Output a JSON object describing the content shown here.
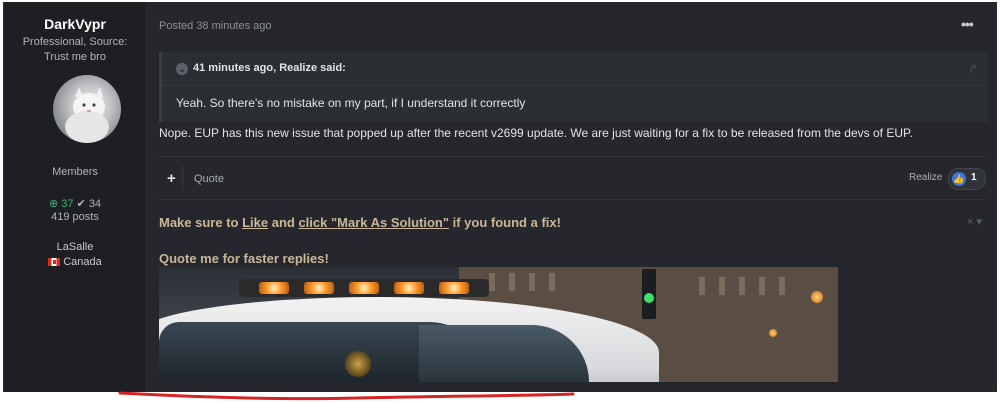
{
  "author": {
    "name": "DarkVypr",
    "title_line1": "Professional, Source:",
    "title_line2": "Trust me bro",
    "group": "Members",
    "reputation_positive": "37",
    "reputation_neutral": "34",
    "posts": "419 posts",
    "location_city": "LaSalle",
    "location_country": "Canada"
  },
  "post": {
    "meta": "Posted 38 minutes ago",
    "menu_icon": "more-dots-icon",
    "quote": {
      "header": "41 minutes ago, Realize said:",
      "text": "Yeah. So there's no mistake on my part, if I understand it correctly"
    },
    "body": "Nope. EUP has this new issue that popped up after the recent v2699 update. We are just waiting for a fix to be released from the devs of EUP.",
    "actions": {
      "add_label": "+",
      "quote_label": "Quote"
    },
    "reactions": {
      "user": "Realize",
      "count": "1",
      "icon": "thumbs-up-icon"
    }
  },
  "signature": {
    "line1_prefix": "Make sure to ",
    "line1_like": "Like",
    "line1_and": " and ",
    "line1_mark": "click \"Mark As Solution\"",
    "line1_suffix": " if you found a fix!",
    "line2": "Quote me for faster replies!",
    "close_label": "× ▾"
  },
  "colors": {
    "background": "#25272c",
    "sidebar": "#1d1f23",
    "signature_text": "#c9b79a",
    "positive_rep": "#3bb273",
    "like_blue": "#3a78e0",
    "annotation_red": "#d42424"
  }
}
